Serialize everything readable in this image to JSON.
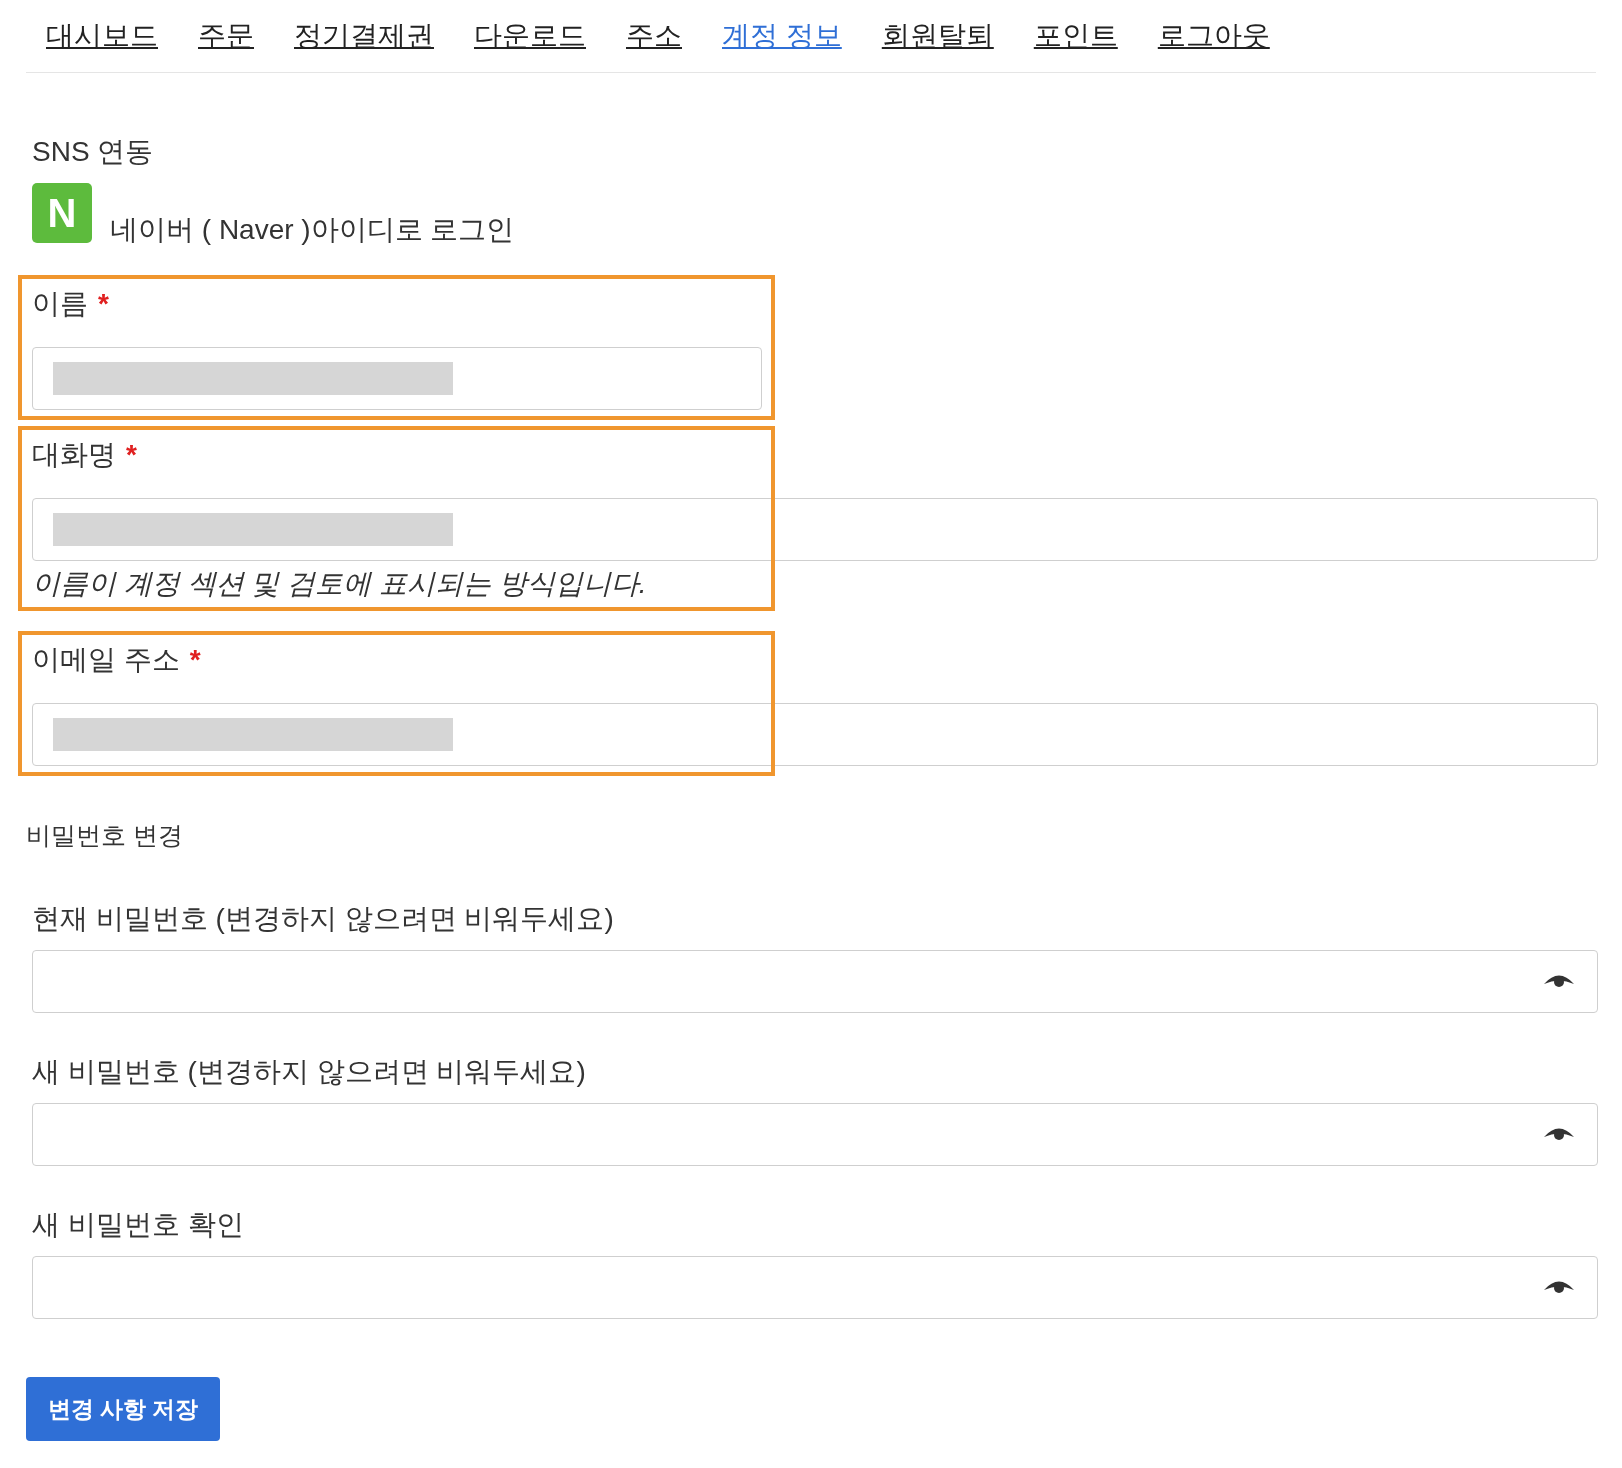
{
  "nav": [
    {
      "label": "대시보드",
      "selected": false
    },
    {
      "label": "주문",
      "selected": false
    },
    {
      "label": "정기결제권",
      "selected": false
    },
    {
      "label": "다운로드",
      "selected": false
    },
    {
      "label": "주소",
      "selected": false
    },
    {
      "label": "계정 정보",
      "selected": true
    },
    {
      "label": "회원탈퇴",
      "selected": false
    },
    {
      "label": "포인트",
      "selected": false
    },
    {
      "label": "로그아웃",
      "selected": false
    }
  ],
  "sns": {
    "title": "SNS 연동",
    "icon_letter": "N",
    "login_text": "네이버 ( Naver )아이디로 로그인"
  },
  "fields": [
    {
      "label": "이름",
      "required_mark": "*",
      "full_width": false,
      "redacted": true,
      "highlighted": true
    },
    {
      "label": "대화명",
      "required_mark": "*",
      "full_width": true,
      "redacted": true,
      "highlighted": true,
      "help": "이름이 계정 섹션 및 검토에 표시되는 방식입니다."
    },
    {
      "label": "이메일 주소",
      "required_mark": "*",
      "full_width": true,
      "redacted": true,
      "highlighted": true
    }
  ],
  "password_section": {
    "title": "비밀번호 변경",
    "fields": [
      {
        "label": "현재 비밀번호 (변경하지 않으려면 비워두세요)"
      },
      {
        "label": "새 비밀번호 (변경하지 않으려면 비워두세요)"
      },
      {
        "label": "새 비밀번호 확인"
      }
    ]
  },
  "save_button": "변경 사항 저장"
}
